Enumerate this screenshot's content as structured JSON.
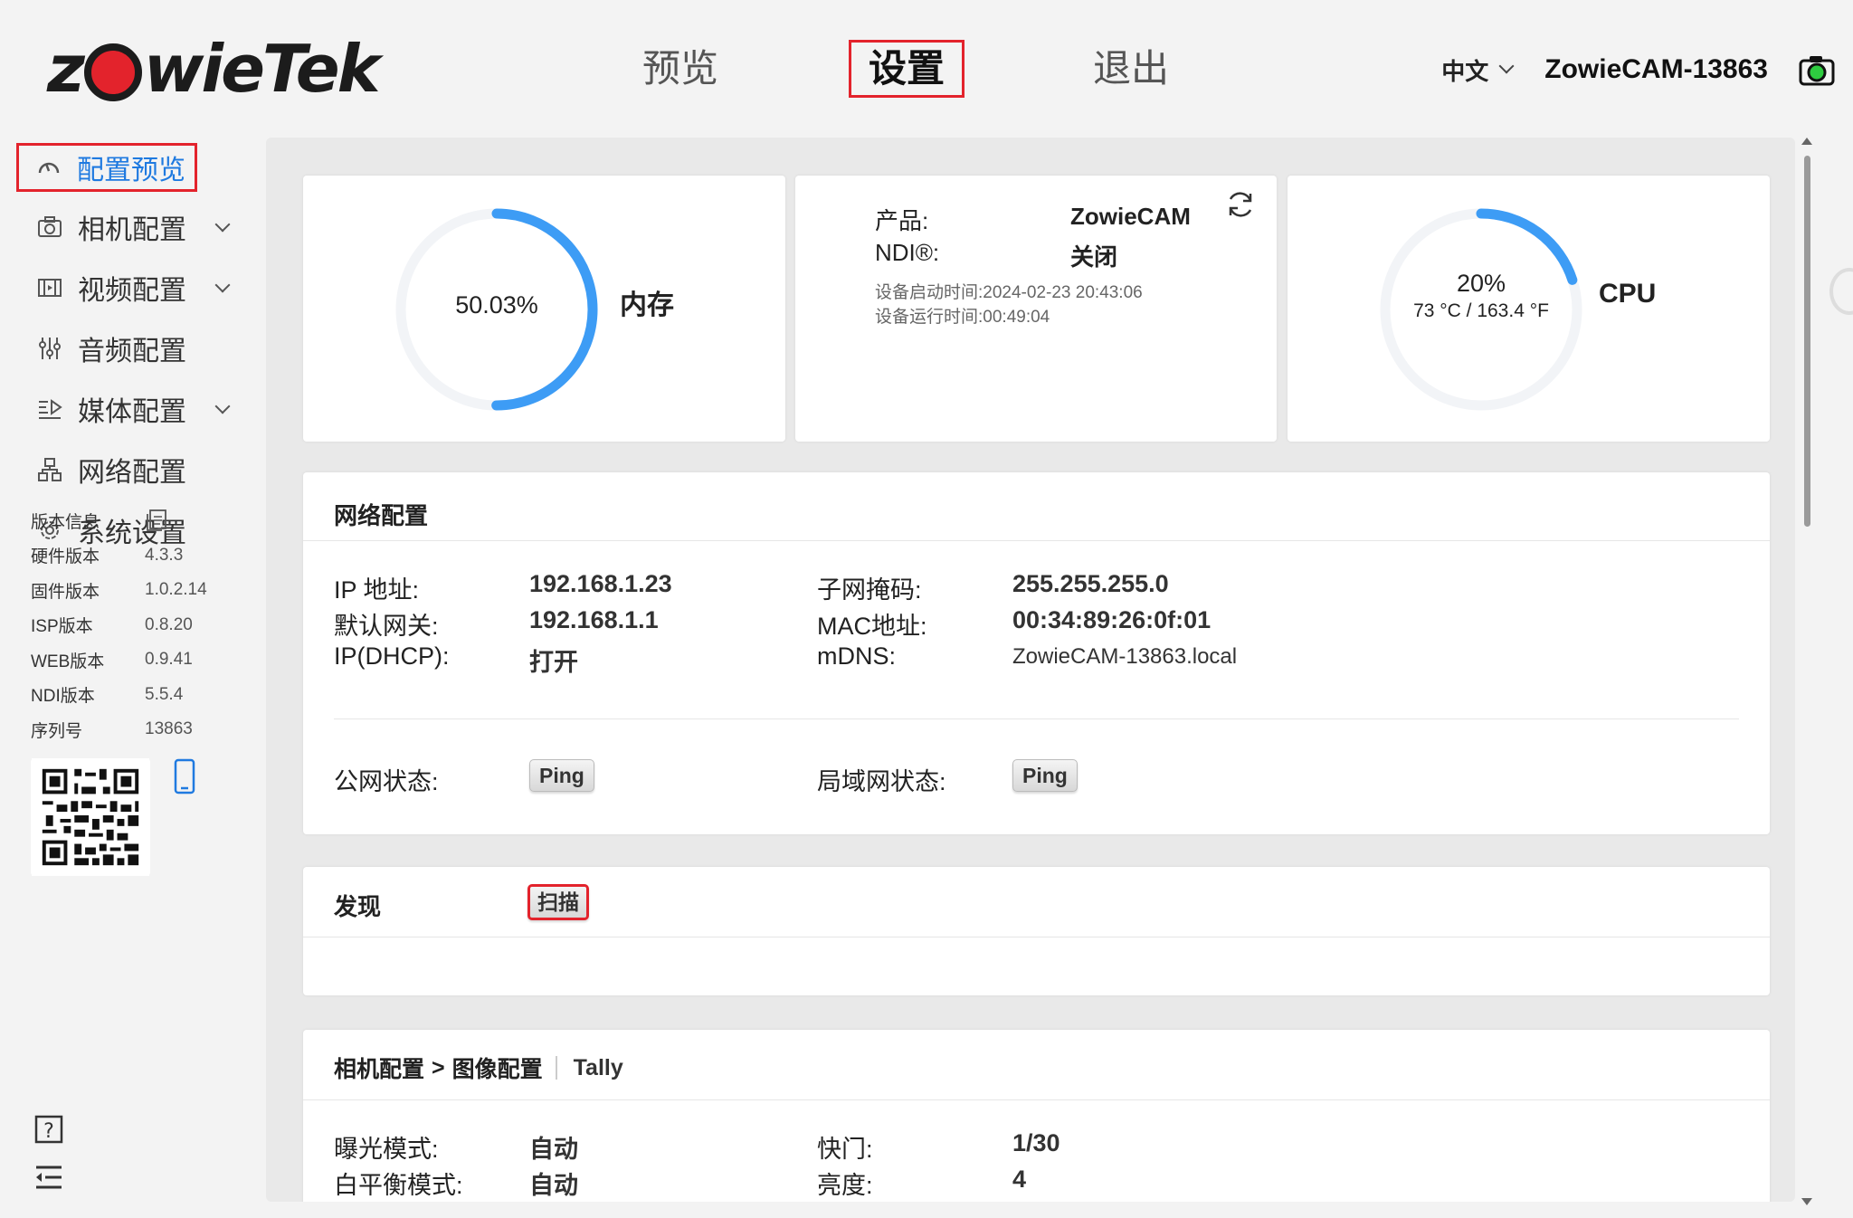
{
  "brand": {
    "logo_text_1": "z",
    "logo_text_2": "wieTek",
    "accent": "#e3232c"
  },
  "nav": {
    "preview": "预览",
    "settings": "设置",
    "logout": "退出"
  },
  "header": {
    "language": "中文",
    "device_name": "ZowieCAM-13863"
  },
  "sidebar": {
    "items": [
      {
        "label": "配置预览"
      },
      {
        "label": "相机配置"
      },
      {
        "label": "视频配置"
      },
      {
        "label": "音频配置"
      },
      {
        "label": "媒体配置"
      },
      {
        "label": "网络配置"
      },
      {
        "label": "系统设置"
      }
    ],
    "versions": {
      "title": "版本信息",
      "rows": [
        {
          "k": "硬件版本",
          "v": "4.3.3"
        },
        {
          "k": "固件版本",
          "v": "1.0.2.14"
        },
        {
          "k": "ISP版本",
          "v": "0.8.20"
        },
        {
          "k": "WEB版本",
          "v": "0.9.41"
        },
        {
          "k": "NDI版本",
          "v": "5.5.4"
        },
        {
          "k": "序列号",
          "v": "13863"
        }
      ]
    }
  },
  "memory": {
    "percent_text": "50.03%",
    "fraction": 0.5003,
    "label": "内存",
    "color": "#3d9cf5"
  },
  "product": {
    "product_key": "产品:",
    "product_val": "ZowieCAM",
    "ndi_key": "NDI®:",
    "ndi_val": "关闭",
    "boot_time": "设备启动时间:2024-02-23 20:43:06",
    "run_time": "设备运行时间:00:49:04"
  },
  "cpu": {
    "percent_text": "20%",
    "fraction": 0.2,
    "temp_text": "73 °C / 163.4 °F",
    "label": "CPU"
  },
  "network": {
    "title": "网络配置",
    "ip_key": "IP 地址:",
    "ip_val": "192.168.1.23",
    "mask_key": "子网掩码:",
    "mask_val": "255.255.255.0",
    "gw_key": "默认网关:",
    "gw_val": "192.168.1.1",
    "mac_key": "MAC地址:",
    "mac_val": "00:34:89:26:0f:01",
    "dhcp_key": "IP(DHCP):",
    "dhcp_val": "打开",
    "mdns_key": "mDNS:",
    "mdns_val": "ZowieCAM-13863.local",
    "wan_key": "公网状态:",
    "lan_key": "局域网状态:",
    "ping_label": "Ping"
  },
  "discovery": {
    "title": "发现",
    "scan_label": "扫描"
  },
  "camera": {
    "crumb_main": "相机配置",
    "crumb_arrow": ">",
    "crumb_sub": "图像配置",
    "crumb_tally": "Tally",
    "exposure_key": "曝光模式:",
    "exposure_val": "自动",
    "shutter_key": "快门:",
    "shutter_val": "1/30",
    "wb_key": "白平衡模式:",
    "wb_val": "自动",
    "brightness_key": "亮度:",
    "brightness_val": "4"
  }
}
